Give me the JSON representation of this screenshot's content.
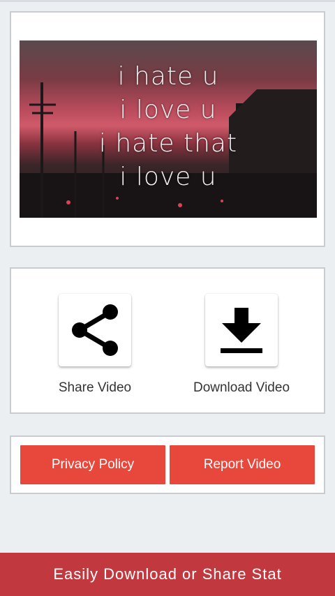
{
  "video": {
    "thumbnail_lines": [
      "i hate u",
      "i love u",
      "i hate that",
      "i love u"
    ]
  },
  "actions": {
    "share_label": "Share Video",
    "share_icon": "share-icon",
    "download_label": "Download Video",
    "download_icon": "download-icon"
  },
  "buttons": {
    "privacy_label": "Privacy Policy",
    "report_label": "Report Video"
  },
  "banner": {
    "text": "Easily Download or Share Stat"
  },
  "colors": {
    "button_red": "#e8473c",
    "banner_red": "#c1393f",
    "background": "#eceff2"
  }
}
